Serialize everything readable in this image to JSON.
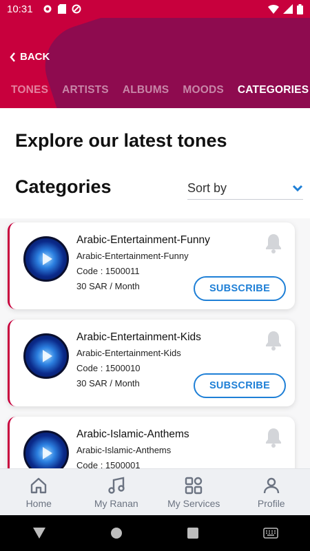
{
  "status_bar": {
    "time": "10:31"
  },
  "header": {
    "back_label": "BACK",
    "tabs": [
      {
        "label": "TONES"
      },
      {
        "label": "ARTISTS"
      },
      {
        "label": "ALBUMS"
      },
      {
        "label": "MOODS"
      },
      {
        "label": "CATEGORIES",
        "active": true
      }
    ]
  },
  "main": {
    "page_title": "Explore our latest tones",
    "section_title": "Categories",
    "sort_label": "Sort by",
    "cards": [
      {
        "title": "Arabic-Entertainment-Funny",
        "subtitle": "Arabic-Entertainment-Funny",
        "code": "Code : 1500011",
        "price": "30 SAR / Month",
        "button": "SUBSCRIBE"
      },
      {
        "title": "Arabic-Entertainment-Kids",
        "subtitle": "Arabic-Entertainment-Kids",
        "code": "Code : 1500010",
        "price": "30 SAR / Month",
        "button": "SUBSCRIBE"
      },
      {
        "title": "Arabic-Islamic-Anthems",
        "subtitle": "Arabic-Islamic-Anthems",
        "code": "Code : 1500001",
        "price": "",
        "button": ""
      }
    ]
  },
  "bottom_nav": [
    {
      "label": "Home",
      "icon": "home-icon"
    },
    {
      "label": "My Ranan",
      "icon": "music-icon"
    },
    {
      "label": "My Services",
      "icon": "grid-icon"
    },
    {
      "label": "Profile",
      "icon": "profile-icon"
    }
  ],
  "colors": {
    "brand": "#c8003d",
    "brand_dark": "#8e0b4f",
    "accent": "#1e7fd6"
  }
}
